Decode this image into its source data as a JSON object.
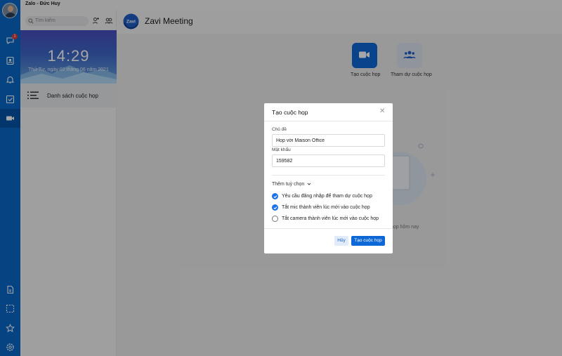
{
  "window": {
    "title": "Zalo - Đức Huy"
  },
  "nav": {
    "badge_count": "1",
    "icons": [
      "chat-icon",
      "contacts-icon",
      "bell-icon",
      "todo-icon",
      "video-icon",
      "document-icon",
      "screenshot-icon",
      "star-icon",
      "settings-icon"
    ],
    "active": "video-icon"
  },
  "sidebar": {
    "search_placeholder": "Tìm kiếm",
    "clock": {
      "time": "14:29",
      "date": "Thứ Tư, ngày 02 tháng 06 năm 2021"
    },
    "list_item": "Danh sách cuộc họp"
  },
  "main": {
    "logo_text": "Zavi",
    "app_title": "Zavi Meeting",
    "actions": [
      {
        "label": "Tạo cuộc họp",
        "icon": "video-camera-icon"
      },
      {
        "label": "Tham dự cuộc họp",
        "icon": "group-icon"
      }
    ],
    "empty_text": "họp hôm nay"
  },
  "modal": {
    "title": "Tạo cuộc họp",
    "topic_label": "Chủ đề",
    "topic_value": "Họp với Maison Office",
    "password_label": "Mật khẩu",
    "password_value": "159582",
    "options_header": "Thêm tuỳ chọn",
    "options": [
      {
        "label": "Yêu cầu đăng nhập để tham dự cuộc họp",
        "checked": true
      },
      {
        "label": "Tắt mic thành viên lúc mới vào cuộc họp",
        "checked": true
      },
      {
        "label": "Tắt camera thành viên lúc mới vào cuộc họp",
        "checked": false
      }
    ],
    "cancel_label": "Hủy",
    "create_label": "Tạo cuộc họp"
  },
  "colors": {
    "accent": "#0d67d6",
    "nav_bg": "#0a68c9",
    "badge": "#e53935"
  }
}
